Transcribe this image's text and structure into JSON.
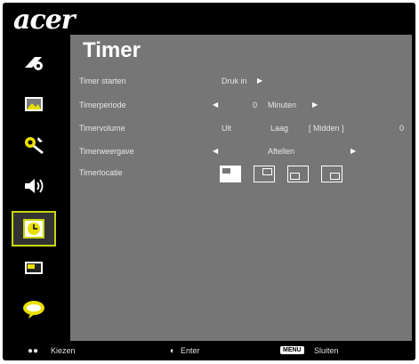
{
  "brand": "acer",
  "title": "Timer",
  "sidebar": {
    "items": [
      {
        "name": "image-settings-icon",
        "color": "#ffffff"
      },
      {
        "name": "picture-icon",
        "color": "#ffffff"
      },
      {
        "name": "settings-icon",
        "color": "#ffffff"
      },
      {
        "name": "speaker-icon",
        "color": "#ffffff"
      },
      {
        "name": "timer-icon",
        "color": "#c8d60a",
        "selected": true
      },
      {
        "name": "display-icon",
        "color": "#ffffff"
      },
      {
        "name": "language-icon",
        "color": "#ffffff"
      }
    ]
  },
  "rows": {
    "start": {
      "label": "Timer starten",
      "value": "Druk in"
    },
    "period": {
      "label": "Timerperiode",
      "value": "0",
      "unit": "Minuten"
    },
    "volume": {
      "label": "Timervolume",
      "opt1": "Uit",
      "opt2": "Laag",
      "opt3": "[ Midden ]",
      "opt4": "0"
    },
    "display": {
      "label": "Timerweergave",
      "value": "Aftellen"
    },
    "location": {
      "label": "Timerlocatie"
    }
  },
  "footer": {
    "select_label": "Kiezen",
    "enter_label": "Enter",
    "menu_key": "MENU",
    "close_label": "Sluiten"
  }
}
